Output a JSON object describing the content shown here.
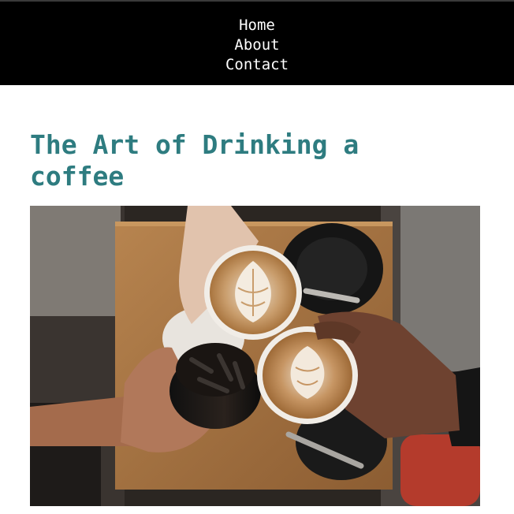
{
  "nav": {
    "items": [
      {
        "label": "Home"
      },
      {
        "label": "About"
      },
      {
        "label": "Contact"
      }
    ]
  },
  "article": {
    "title": "The Art of Drinking a coffee"
  },
  "hero_image": {
    "alt": "Four hands toasting with cups of coffee over a wooden table"
  },
  "colors": {
    "nav_background": "#000000",
    "nav_text": "#ffffff",
    "title": "#2e7c80",
    "page_background": "#ffffff"
  }
}
